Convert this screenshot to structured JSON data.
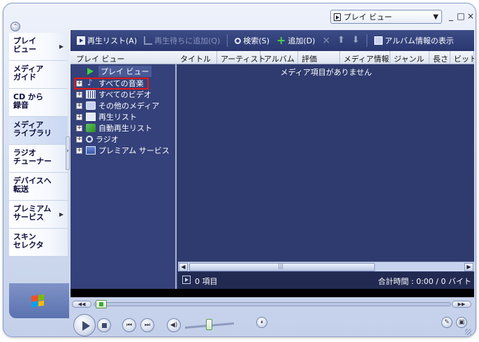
{
  "title_bar": {
    "view_selector": "プレイ ビュー",
    "minimize": "_",
    "maximize": "□",
    "close": "×"
  },
  "nav": {
    "items": [
      {
        "label": "プレイ\nビュー",
        "arrow": "▶"
      },
      {
        "label": "メディア\nガイド",
        "arrow": ""
      },
      {
        "label": "CD から\n録音",
        "arrow": ""
      },
      {
        "label": "メディア\nライブラリ",
        "arrow": ""
      },
      {
        "label": "ラジオ\nチューナー",
        "arrow": ""
      },
      {
        "label": "デバイスへ\n転送",
        "arrow": ""
      },
      {
        "label": "プレミアム\nサービス",
        "arrow": "▶"
      },
      {
        "label": "スキン\nセレクタ",
        "arrow": ""
      }
    ]
  },
  "toolbar": {
    "playlist": "再生リスト(A)",
    "add_to_queue": "再生待ちに追加(Q)",
    "search": "検索(S)",
    "add": "追加(D)",
    "delete": "×",
    "up": "⬆",
    "down": "⬇",
    "album_info": "アルバム情報の表示"
  },
  "tree_header": "プレイ ビュー",
  "columns": [
    "タイトル",
    "アーティスト",
    "アルバム",
    "評価",
    "メディア情報",
    "ジャンル",
    "長さ",
    "ビット"
  ],
  "tree": {
    "now_playing": "プレイ ビュー",
    "items": [
      "すべての音楽",
      "すべてのビデオ",
      "その他のメディア",
      "再生リスト",
      "自動再生リスト",
      "ラジオ",
      "プレミアム サービス"
    ]
  },
  "content": {
    "empty_message": "メディア項目がありません"
  },
  "status": {
    "item_count": "0 項目",
    "total": "合計時間 : 0:00 / 0 バイト"
  },
  "colors": {
    "panel": "#2f3b6e",
    "highlight_box": "#e01818"
  }
}
